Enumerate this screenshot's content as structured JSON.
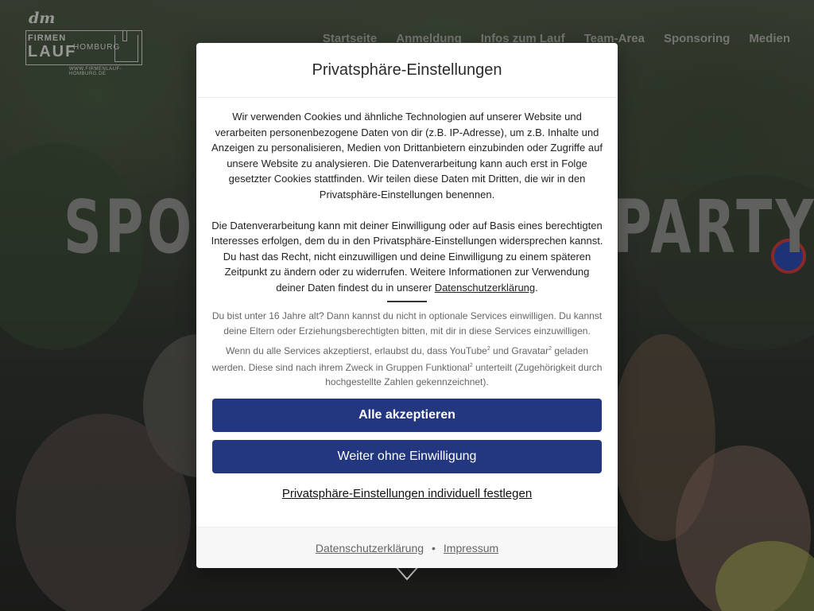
{
  "header": {
    "logo": {
      "brand": "dm",
      "line1": "FIRMEN",
      "line2": "LAUF",
      "city": "HOMBURG",
      "url": "WWW.FIRMENLAUF-HOMBURG.DE"
    },
    "nav": [
      "Startseite",
      "Anmeldung",
      "Infos zum Lauf",
      "Team-Area",
      "Sponsoring",
      "Medien"
    ]
  },
  "hero": {
    "title": "SPORT · SPASS · PARTY"
  },
  "dialog": {
    "title": "Privatsphäre-Einstellungen",
    "paragraph1": "Wir verwenden Cookies und ähnliche Technologien auf unserer Website und verarbeiten personenbezogene Daten von dir (z.B. IP-Adresse), um z.B. Inhalte und Anzeigen zu personalisieren, Medien von Drittanbietern einzubinden oder Zugriffe auf unsere Website zu analysieren. Die Datenverarbeitung kann auch erst in Folge gesetzter Cookies stattfinden. Wir teilen diese Daten mit Dritten, die wir in den Privatsphäre-Einstellungen benennen.",
    "paragraph2": "Die Datenverarbeitung kann mit deiner Einwilligung oder auf Basis eines berechtigten Interesses erfolgen, dem du in den Privatsphäre-Einstellungen widersprechen kannst. Du hast das Recht, nicht einzuwilligen und deine Einwilligung zu einem späteren Zeitpunkt zu ändern oder zu widerrufen. Weitere Informationen zur Verwendung deiner Daten findest du in unserer",
    "paragraph2_link": "Datenschutzerklärung",
    "paragraph2_end": ".",
    "age_notice": "Du bist unter 16 Jahre alt? Dann kannst du nicht in optionale Services einwilligen. Du kannst deine Eltern oder Erziehungsberechtigten bitten, mit dir in diese Services einzuwilligen.",
    "services_a": "Wenn du alle Services akzeptierst, erlaubst du, dass YouTube",
    "services_sup1": "2",
    "services_b": " und Gravatar",
    "services_sup2": "2",
    "services_c": " geladen werden. Diese sind nach ihrem Zweck in Gruppen Funktional",
    "services_sup3": "2",
    "services_d": " unterteilt (Zugehörigkeit durch hochgestellte Zahlen gekennzeichnet).",
    "accept_all": "Alle akzeptieren",
    "continue_without": "Weiter ohne Einwilligung",
    "individual": "Privatsphäre-Einstellungen individuell festlegen",
    "footer": {
      "privacy": "Datenschutzerklärung",
      "separator": "•",
      "imprint": "Impressum"
    }
  }
}
